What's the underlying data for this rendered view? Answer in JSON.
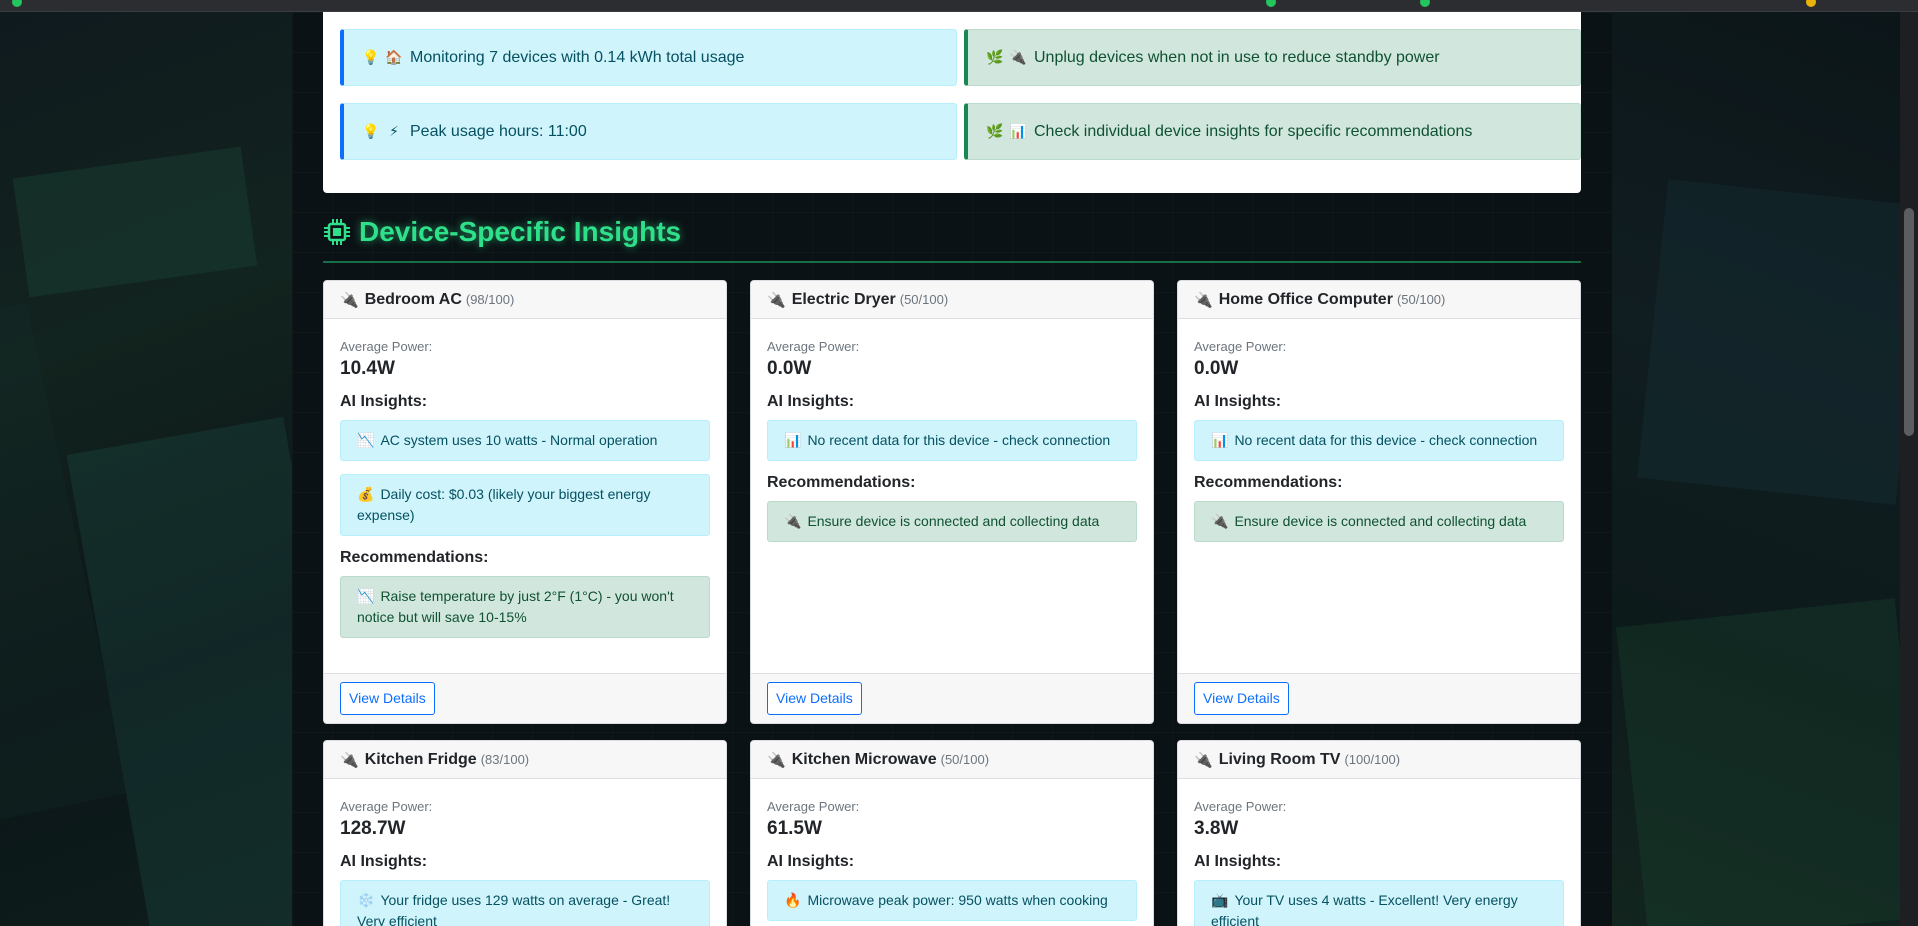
{
  "tips": [
    {
      "icon1": "💡",
      "icon2": "🏠",
      "text": "Monitoring 7 devices with 0.14 kWh total usage",
      "kind": "info"
    },
    {
      "icon1": "🌿",
      "icon2": "🔌",
      "text": "Unplug devices when not in use to reduce standby power",
      "kind": "success"
    },
    {
      "icon1": "💡",
      "icon2": "⚡",
      "text": "Peak usage hours: 11:00",
      "kind": "info"
    },
    {
      "icon1": "🌿",
      "icon2": "📊",
      "text": "Check individual device insights for specific recommendations",
      "kind": "success"
    }
  ],
  "section": {
    "icon": "chip-icon",
    "title": "Device-Specific Insights"
  },
  "labels": {
    "average_power": "Average Power:",
    "ai_insights": "AI Insights:",
    "recommendations": "Recommendations:",
    "view_details": "View Details"
  },
  "devices": [
    {
      "name": "Bedroom AC",
      "score": "(98/100)",
      "power": "10.4W",
      "insights": [
        {
          "icon": "📉",
          "text": "AC system uses 10 watts - Normal operation"
        },
        {
          "icon": "💰",
          "text": "Daily cost: $0.03 (likely your biggest energy expense)"
        }
      ],
      "recommendations": [
        {
          "icon": "📉",
          "text": "Raise temperature by just 2°F (1°C) - you won't notice but will save 10-15%"
        }
      ]
    },
    {
      "name": "Electric Dryer",
      "score": "(50/100)",
      "power": "0.0W",
      "insights": [
        {
          "icon": "📊",
          "text": "No recent data for this device - check connection"
        }
      ],
      "recommendations": [
        {
          "icon": "🔌",
          "text": "Ensure device is connected and collecting data"
        }
      ]
    },
    {
      "name": "Home Office Computer",
      "score": "(50/100)",
      "power": "0.0W",
      "insights": [
        {
          "icon": "📊",
          "text": "No recent data for this device - check connection"
        }
      ],
      "recommendations": [
        {
          "icon": "🔌",
          "text": "Ensure device is connected and collecting data"
        }
      ]
    },
    {
      "name": "Kitchen Fridge",
      "score": "(83/100)",
      "power": "128.7W",
      "insights": [
        {
          "icon": "❄️",
          "text": "Your fridge uses 129 watts on average - Great! Very efficient"
        }
      ]
    },
    {
      "name": "Kitchen Microwave",
      "score": "(50/100)",
      "power": "61.5W",
      "insights": [
        {
          "icon": "🔥",
          "text": "Microwave peak power: 950 watts when cooking"
        }
      ]
    },
    {
      "name": "Living Room TV",
      "score": "(100/100)",
      "power": "3.8W",
      "insights": [
        {
          "icon": "📺",
          "text": "Your TV uses 4 watts - Excellent! Very energy efficient"
        }
      ]
    }
  ],
  "colors": {
    "accent": "#2fe08a",
    "info_bg": "#cff4fc",
    "success_bg": "#d1e7dd",
    "link": "#0d6efd"
  }
}
